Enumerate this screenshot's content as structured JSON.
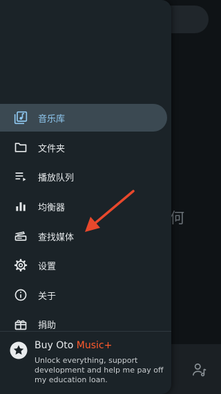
{
  "background": {
    "partial_text": "何"
  },
  "nav": {
    "items": [
      {
        "label": "音乐库",
        "icon": "music-library-icon",
        "active": true
      },
      {
        "label": "文件夹",
        "icon": "folder-icon",
        "active": false
      },
      {
        "label": "播放队列",
        "icon": "queue-icon",
        "active": false
      },
      {
        "label": "均衡器",
        "icon": "equalizer-icon",
        "active": false
      },
      {
        "label": "查找媒体",
        "icon": "scan-media-icon",
        "active": false
      },
      {
        "label": "设置",
        "icon": "gear-icon",
        "active": false
      },
      {
        "label": "关于",
        "icon": "info-icon",
        "active": false
      },
      {
        "label": "捐助",
        "icon": "gift-icon",
        "active": false
      }
    ]
  },
  "promo": {
    "title_prefix": "Buy Oto ",
    "title_accent": "Music+",
    "description": "Unlock everything, support development and help me pay off my education loan."
  },
  "colors": {
    "drawer_bg": "#1b2328",
    "active_item_bg": "#3b4952",
    "active_text": "#8fc8f0",
    "accent": "#ff5a2c",
    "annotation_arrow": "#e8482c"
  }
}
